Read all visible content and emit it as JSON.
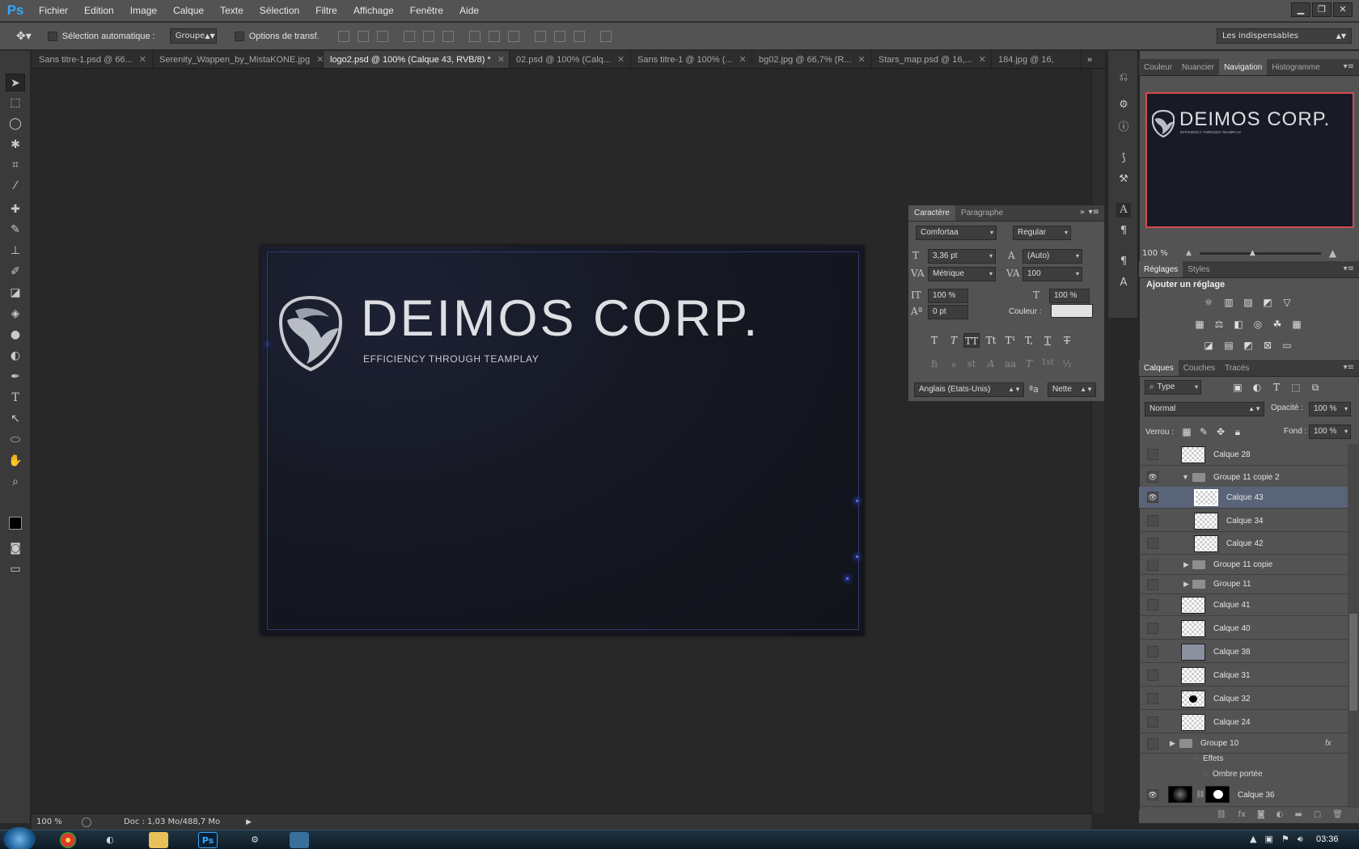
{
  "app": {
    "logo": "Ps"
  },
  "menu": [
    "Fichier",
    "Edition",
    "Image",
    "Calque",
    "Texte",
    "Sélection",
    "Filtre",
    "Affichage",
    "Fenêtre",
    "Aide"
  ],
  "window_controls": [
    "minimize-icon",
    "restore-icon",
    "close-icon"
  ],
  "options": {
    "auto_select_label": "Sélection automatique :",
    "auto_select_value": "Groupe",
    "transform_label": "Options de transf.",
    "workspace": "Les indispensables"
  },
  "tabs": [
    {
      "label": "Sans titre-1.psd @ 66..."
    },
    {
      "label": "Serenity_Wappen_by_MistaKONE.jpg"
    },
    {
      "label": "logo2.psd @ 100% (Calque 43, RVB/8) *"
    },
    {
      "label": "02.psd @ 100% (Calq..."
    },
    {
      "label": "Sans titre-1 @ 100% (..."
    },
    {
      "label": "bg02.jpg @ 66,7% (R..."
    },
    {
      "label": "Stars_map.psd @ 16,..."
    },
    {
      "label": "184.jpg @ 16,"
    }
  ],
  "document": {
    "title": "DEIMOS CORP.",
    "subtitle": "EFFICIENCY THROUGH TEAMPLAY"
  },
  "status": {
    "zoom": "100 %",
    "doc_size": "Doc : 1,03 Mo/488,7 Mo"
  },
  "character_panel": {
    "tabs": [
      "Caractère",
      "Paragraphe"
    ],
    "font": "Comfortaa",
    "style": "Regular",
    "size": "3,36 pt",
    "leading": "(Auto)",
    "kerning": "Métrique",
    "tracking": "100",
    "vscale": "100 %",
    "hscale": "100 %",
    "baseline": "0 pt",
    "color_label": "Couleur :",
    "language": "Anglais (Etats-Unis)",
    "aa_label": "ªa",
    "antialias": "Nette",
    "type_buttons": [
      "T",
      "T",
      "TT",
      "Tt",
      "T¹",
      "T,",
      "T",
      "T"
    ],
    "ot_buttons": [
      "fi",
      "ℴ",
      "st",
      "A",
      "aa",
      "T",
      "1st",
      "½"
    ]
  },
  "nav_panel": {
    "tabs": [
      "Couleur",
      "Nuancier",
      "Navigation",
      "Histogramme"
    ],
    "zoom": "100 %"
  },
  "adjust_panel": {
    "tabs": [
      "Réglages",
      "Styles"
    ],
    "heading": "Ajouter un réglage"
  },
  "layers_panel": {
    "tabs": [
      "Calques",
      "Couches",
      "Tracés"
    ],
    "filter_label": "Type",
    "blend_mode": "Normal",
    "opacity_label": "Opacité :",
    "opacity": "100 %",
    "lock_label": "Verrou :",
    "fill_label": "Fond :",
    "fill": "100 %",
    "layers": [
      {
        "name": "Calque 28",
        "visible": false,
        "indent": 0,
        "kind": "layer"
      },
      {
        "name": "Groupe 11 copie 2",
        "visible": true,
        "indent": 0,
        "kind": "group-open"
      },
      {
        "name": "Calque 43",
        "visible": true,
        "indent": 1,
        "kind": "layer",
        "selected": true
      },
      {
        "name": "Calque 34",
        "visible": false,
        "indent": 1,
        "kind": "layer"
      },
      {
        "name": "Calque 42",
        "visible": false,
        "indent": 1,
        "kind": "layer"
      },
      {
        "name": "Groupe 11 copie",
        "visible": false,
        "indent": 0,
        "kind": "group"
      },
      {
        "name": "Groupe 11",
        "visible": false,
        "indent": 0,
        "kind": "group"
      },
      {
        "name": "Calque 41",
        "visible": false,
        "indent": 0,
        "kind": "layer"
      },
      {
        "name": "Calque 40",
        "visible": false,
        "indent": 0,
        "kind": "layer"
      },
      {
        "name": "Calque 38",
        "visible": false,
        "indent": 0,
        "kind": "layer"
      },
      {
        "name": "Calque 31",
        "visible": false,
        "indent": 0,
        "kind": "layer"
      },
      {
        "name": "Calque 32",
        "visible": false,
        "indent": 0,
        "kind": "layer"
      },
      {
        "name": "Calque 24",
        "visible": false,
        "indent": 0,
        "kind": "layer"
      }
    ],
    "group10": "Groupe 10",
    "effects": "Effets",
    "drop_shadow": "Ombre portée",
    "calque36": "Calque 36",
    "fx": "fx"
  },
  "taskbar": {
    "time": "03:36"
  }
}
